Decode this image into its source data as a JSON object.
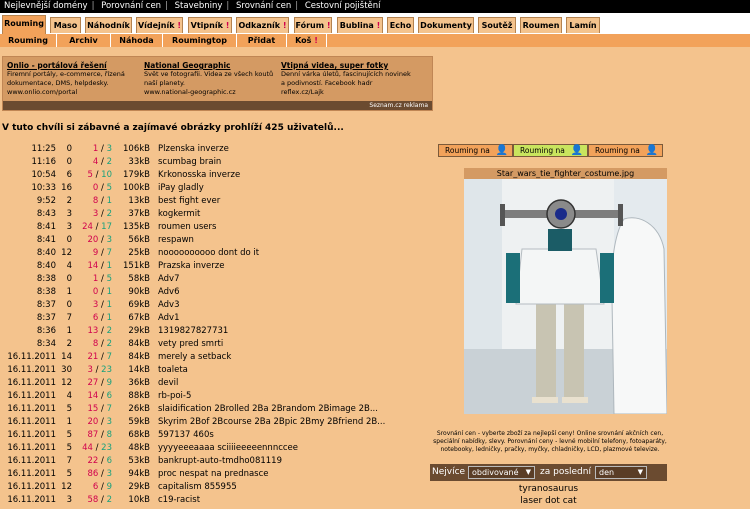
{
  "topbar": [
    "Nejlevnější domény",
    "Porovnání cen",
    "Stavebniny",
    "Srovnání cen",
    "Cestovní pojištění"
  ],
  "tabs": [
    {
      "label": "Rouming",
      "bang": "",
      "active": true
    },
    {
      "label": "Maso",
      "bang": ""
    },
    {
      "label": "Náhodník",
      "bang": ""
    },
    {
      "label": "Vídejník",
      "bang": "!"
    },
    {
      "label": "Vtipník",
      "bang": "!"
    },
    {
      "label": "Odkazník",
      "bang": "!"
    },
    {
      "label": "Fórum",
      "bang": "!"
    },
    {
      "label": "Bublina",
      "bang": "!"
    },
    {
      "label": "Echo",
      "bang": ""
    },
    {
      "label": "Dokumenty",
      "bang": ""
    },
    {
      "label": "Soutěž",
      "bang": ""
    },
    {
      "label": "Roumen",
      "bang": ""
    },
    {
      "label": "Lamín",
      "bang": ""
    }
  ],
  "subnav": [
    {
      "label": "Rouming",
      "bang": ""
    },
    {
      "label": "Archiv",
      "bang": ""
    },
    {
      "label": "Náhoda",
      "bang": ""
    },
    {
      "label": "Roumingtop",
      "bang": ""
    },
    {
      "label": "Přidat",
      "bang": ""
    },
    {
      "label": "Koš",
      "bang": "!"
    }
  ],
  "ads": [
    {
      "title": "Onlio - portálová řešení",
      "text": "Firemní portály, e-commerce, řízená dokumentace, DMS, helpdesky.",
      "url": "www.onlio.com/portal"
    },
    {
      "title": "National Geographic",
      "text": "Svět ve fotografii. Videa ze všech koutů naší planety.",
      "url": "www.national-geographic.cz"
    },
    {
      "title": "Vtipná videa, super fotky",
      "text": "Denní várka úletů, fascinujících novinek a podivností. Facebook hadr",
      "url": "reflex.cz/Lajk"
    }
  ],
  "ad_footer": "Seznam.cz reklama",
  "headline": "V tuto chvíli si zábavné a zajímavé obrázky prohlíží 425 uživatelů...",
  "rows": [
    {
      "time": "11:25",
      "c1": "0",
      "a": "1",
      "b": "3",
      "size": "106kB",
      "title": "Plzenska inverze"
    },
    {
      "time": "11:16",
      "c1": "0",
      "a": "4",
      "b": "2",
      "size": "33kB",
      "title": "scumbag brain"
    },
    {
      "time": "10:54",
      "c1": "6",
      "a": "5",
      "b": "10",
      "size": "179kB",
      "title": "Krkonosska inverze"
    },
    {
      "time": "10:33",
      "c1": "16",
      "a": "0",
      "b": "5",
      "size": "100kB",
      "title": "iPay gladly"
    },
    {
      "time": "9:52",
      "c1": "2",
      "a": "8",
      "b": "1",
      "size": "13kB",
      "title": "best fight ever"
    },
    {
      "time": "8:43",
      "c1": "3",
      "a": "3",
      "b": "2",
      "size": "37kB",
      "title": "kogkermit"
    },
    {
      "time": "8:41",
      "c1": "3",
      "a": "24",
      "b": "17",
      "size": "135kB",
      "title": "roumen users"
    },
    {
      "time": "8:41",
      "c1": "0",
      "a": "20",
      "b": "3",
      "size": "56kB",
      "title": "respawn"
    },
    {
      "time": "8:40",
      "c1": "12",
      "a": "9",
      "b": "7",
      "size": "25kB",
      "title": "noooooooooo dont do it"
    },
    {
      "time": "8:40",
      "c1": "4",
      "a": "14",
      "b": "1",
      "size": "151kB",
      "title": "Prazska inverze"
    },
    {
      "time": "8:38",
      "c1": "0",
      "a": "1",
      "b": "5",
      "size": "58kB",
      "title": "Adv7"
    },
    {
      "time": "8:38",
      "c1": "1",
      "a": "0",
      "b": "1",
      "size": "90kB",
      "title": "Adv6"
    },
    {
      "time": "8:37",
      "c1": "0",
      "a": "3",
      "b": "1",
      "size": "69kB",
      "title": "Adv3"
    },
    {
      "time": "8:37",
      "c1": "7",
      "a": "6",
      "b": "1",
      "size": "67kB",
      "title": "Adv1"
    },
    {
      "time": "8:36",
      "c1": "1",
      "a": "13",
      "b": "2",
      "size": "29kB",
      "title": "1319827827731"
    },
    {
      "time": "8:34",
      "c1": "2",
      "a": "8",
      "b": "2",
      "size": "84kB",
      "title": "vety pred smrti"
    },
    {
      "time": "16.11.2011",
      "c1": "14",
      "a": "21",
      "b": "7",
      "size": "84kB",
      "title": "merely a setback"
    },
    {
      "time": "16.11.2011",
      "c1": "30",
      "a": "3",
      "b": "23",
      "size": "14kB",
      "title": "toaleta"
    },
    {
      "time": "16.11.2011",
      "c1": "12",
      "a": "27",
      "b": "9",
      "size": "36kB",
      "title": "devil"
    },
    {
      "time": "16.11.2011",
      "c1": "4",
      "a": "14",
      "b": "6",
      "size": "88kB",
      "title": "rb-poi-5"
    },
    {
      "time": "16.11.2011",
      "c1": "5",
      "a": "15",
      "b": "7",
      "size": "26kB",
      "title": "slaidification 2Brolled 2Ba 2Brandom 2Bimage 2B..."
    },
    {
      "time": "16.11.2011",
      "c1": "1",
      "a": "20",
      "b": "3",
      "size": "59kB",
      "title": "Skyrim 2Bof 2Bcourse 2Ba 2Bpic 2Bmy 2Bfriend 2B..."
    },
    {
      "time": "16.11.2011",
      "c1": "5",
      "a": "87",
      "b": "8",
      "size": "68kB",
      "title": "597137 460s"
    },
    {
      "time": "16.11.2011",
      "c1": "5",
      "a": "44",
      "b": "23",
      "size": "48kB",
      "title": "yyyyeeeaaaa sciiiieeeeennnccee"
    },
    {
      "time": "16.11.2011",
      "c1": "7",
      "a": "22",
      "b": "6",
      "size": "53kB",
      "title": "bankrupt-auto-tmdho081119"
    },
    {
      "time": "16.11.2011",
      "c1": "5",
      "a": "86",
      "b": "3",
      "size": "94kB",
      "title": "proc nespat na prednasce"
    },
    {
      "time": "16.11.2011",
      "c1": "12",
      "a": "6",
      "b": "9",
      "size": "29kB",
      "title": "capitalism 855955"
    },
    {
      "time": "16.11.2011",
      "c1": "3",
      "a": "58",
      "b": "2",
      "size": "10kB",
      "title": "c19-racist"
    }
  ],
  "rouming_buttons": [
    {
      "label": "Rouming na",
      "glyph": "👤",
      "color": "#f2a25a"
    },
    {
      "label": "Rouming na",
      "glyph": "👤",
      "color": "#c9e55e"
    },
    {
      "label": "Rouming na",
      "glyph": "👤",
      "color": "#f2a25a"
    }
  ],
  "image": {
    "caption": "Star_wars_tie_fighter_costume.jpg"
  },
  "footnote": "Srovnání cen - vyberte zboží za nejlepší ceny! Online srovnání akčních cen, speciální nabídky, slevy. Porovnání ceny - levné mobilní telefony, fotoaparáty, notebooky, ledničky, pračky, myčky, chladničky, LCD, plazmové televize.",
  "filter": {
    "prefix": "Nejvíce",
    "select1": "obdivované",
    "middle": "za poslední",
    "select2": "den"
  },
  "toplist": [
    "tyranosaurus",
    "laser dot cat"
  ]
}
